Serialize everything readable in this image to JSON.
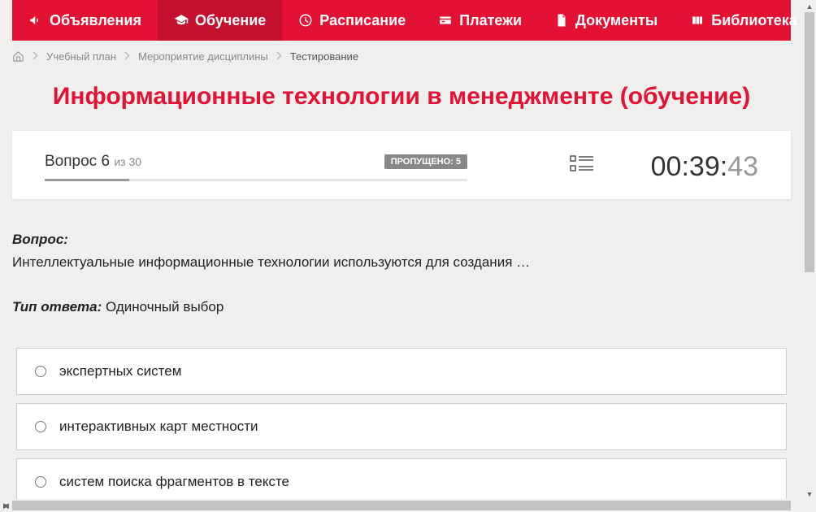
{
  "nav": {
    "items": [
      {
        "label": "Объявления"
      },
      {
        "label": "Обучение"
      },
      {
        "label": "Расписание"
      },
      {
        "label": "Платежи"
      },
      {
        "label": "Документы"
      },
      {
        "label": "Библиотека"
      }
    ]
  },
  "breadcrumb": {
    "items": [
      {
        "label": "Учебный план"
      },
      {
        "label": "Мероприятие дисциплины"
      },
      {
        "label": "Тестирование"
      }
    ]
  },
  "page_title": "Информационные технологии в менеджменте (обучение)",
  "status": {
    "question_word": "Вопрос",
    "current": "6",
    "of_word": "из",
    "total": "30",
    "skipped_label": "ПРОПУЩЕНО: 5",
    "timer_main": "00:39:",
    "timer_sec": "43"
  },
  "question": {
    "label": "Вопрос:",
    "text": "Интеллектуальные информационные технологии используются для создания …",
    "answer_type_label": "Тип ответа:",
    "answer_type_value": " Одиночный выбор",
    "options": [
      "экспертных систем",
      "интерактивных карт местности",
      "систем поиска фрагментов в тексте"
    ]
  }
}
